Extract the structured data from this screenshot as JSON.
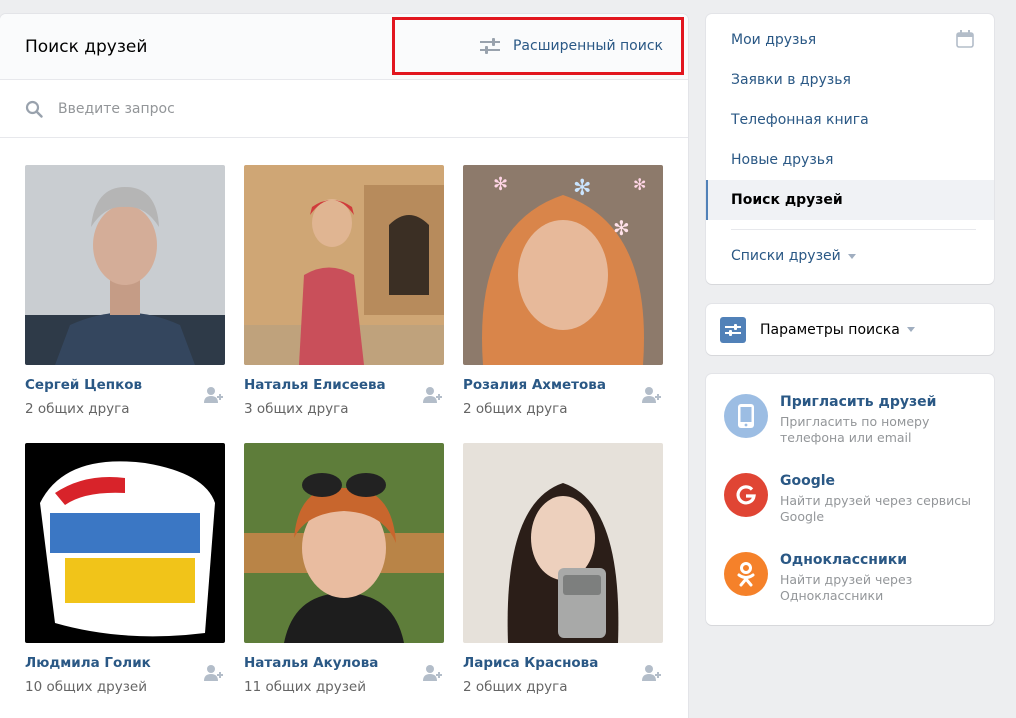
{
  "main": {
    "title": "Поиск друзей",
    "advanced_search_label": "Расширенный поиск",
    "search_placeholder": "Введите запрос"
  },
  "people": [
    {
      "name": "Сергей Цепков",
      "common": "2 общих друга"
    },
    {
      "name": "Наталья Елисеева",
      "common": "3 общих друга"
    },
    {
      "name": "Розалия Ахметова",
      "common": "2 общих друга"
    },
    {
      "name": "Людмила Голик",
      "common": "10 общих друзей"
    },
    {
      "name": "Наталья Акулова",
      "common": "11 общих друзей"
    },
    {
      "name": "Лариса Краснова",
      "common": "2 общих друга"
    }
  ],
  "menu": {
    "items": [
      {
        "label": "Мои друзья"
      },
      {
        "label": "Заявки в друзья"
      },
      {
        "label": "Телефонная книга"
      },
      {
        "label": "Новые друзья"
      },
      {
        "label": "Поиск друзей"
      }
    ],
    "lists_label": "Списки друзей"
  },
  "params": {
    "label": "Параметры поиска"
  },
  "invite": [
    {
      "title": "Пригласить друзей",
      "desc": "Пригласить по номеру телефона или email",
      "icon": "phone-icon",
      "color": "#9cbde3"
    },
    {
      "title": "Google",
      "desc": "Найти друзей через сервисы Google",
      "icon": "google-icon",
      "color": "#e04534"
    },
    {
      "title": "Одноклассники",
      "desc": "Найти друзей через Одноклассники",
      "icon": "odnoklassniki-icon",
      "color": "#f5812a"
    }
  ],
  "colors": {
    "link": "#2a5885",
    "accent": "#5181b8",
    "highlight_border": "#e2161f"
  }
}
